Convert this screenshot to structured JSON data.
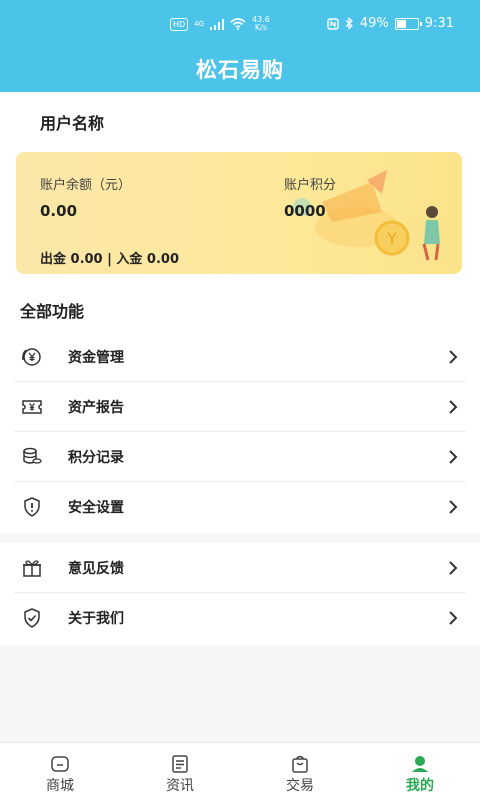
{
  "status_bar": {
    "network_badge": "HD",
    "network_type": "4G",
    "speed_value": "43.6",
    "speed_unit": "K/s",
    "battery": "49%",
    "battery_level": 0.49,
    "time": "9:31"
  },
  "header": {
    "title": "松石易购"
  },
  "user": {
    "name": "用户名称"
  },
  "account_card": {
    "balance_label": "账户余额（元）",
    "balance_value": "0.00",
    "points_label": "账户积分",
    "points_value": "0000",
    "flow_text": "出金 0.00 | 入金 0.00"
  },
  "features": {
    "title": "全部功能",
    "group1": [
      {
        "label": "资金管理",
        "icon": "yen-circle-icon"
      },
      {
        "label": "资产报告",
        "icon": "yen-ticket-icon"
      },
      {
        "label": "积分记录",
        "icon": "coins-stack-icon"
      },
      {
        "label": "安全设置",
        "icon": "shield-alert-icon"
      }
    ],
    "group2": [
      {
        "label": "意见反馈",
        "icon": "gift-icon"
      },
      {
        "label": "关于我们",
        "icon": "shield-check-icon"
      }
    ]
  },
  "tabbar": {
    "items": [
      {
        "label": "商城",
        "icon": "home-icon",
        "active": false
      },
      {
        "label": "资讯",
        "icon": "news-icon",
        "active": false
      },
      {
        "label": "交易",
        "icon": "bag-icon",
        "active": false
      },
      {
        "label": "我的",
        "icon": "person-icon",
        "active": true
      }
    ],
    "active_color": "#2aa854"
  },
  "colors": {
    "header": "#4cc3e8",
    "card": "#fde99b",
    "accent": "#2aa854"
  }
}
